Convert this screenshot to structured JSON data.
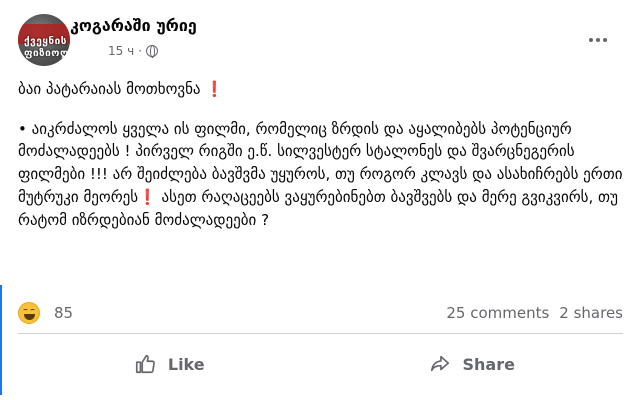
{
  "post": {
    "author": "კოგარაში ურიე",
    "avatar_text_line1": "ქვეყნის",
    "avatar_text_line2": "ფიზიოლოგი",
    "timestamp": "15 ч"
  },
  "content": {
    "title_line": "ბაი პატარაიას მოთხოვნა",
    "title_emoji": "❗",
    "body_part1": "• აიკრძალოს ყველა ის ფილმი, რომელიც ზრდის და აყალიბებს პოტენციურ მოძალადეებს ! პირველ რიგში ე.წ. სილვესტერ სტალონეს და შვარცნეგერის ფილმები !!! არ შეიძლება ბავშვმა უყუროს, თუ როგორ კლავს და ასახიჩრებს ერთი მუტრუკი მეორეს",
    "body_emoji": "❗",
    "body_part2": " ასეთ რაღაცეებს ვაყურებინებთ ბავშვებს და მერე გვიკვირს, თუ რატომ იზრდებიან მოძალადეები ?"
  },
  "stats": {
    "reaction_count": "85",
    "comments": "25 comments",
    "shares": "2 shares"
  },
  "actions": {
    "like_label": "Like",
    "share_label": "Share"
  },
  "colors": {
    "text_primary": "#050505",
    "text_secondary": "#65676b",
    "divider": "#ced0d4",
    "accent": "#1877f2",
    "emoji_red": "#e0245e"
  },
  "icons": {
    "privacy": "globe-icon",
    "more": "more-dots-icon",
    "reaction": "haha-emoji-icon",
    "like": "thumbs-up-icon",
    "share": "share-arrow-icon"
  }
}
